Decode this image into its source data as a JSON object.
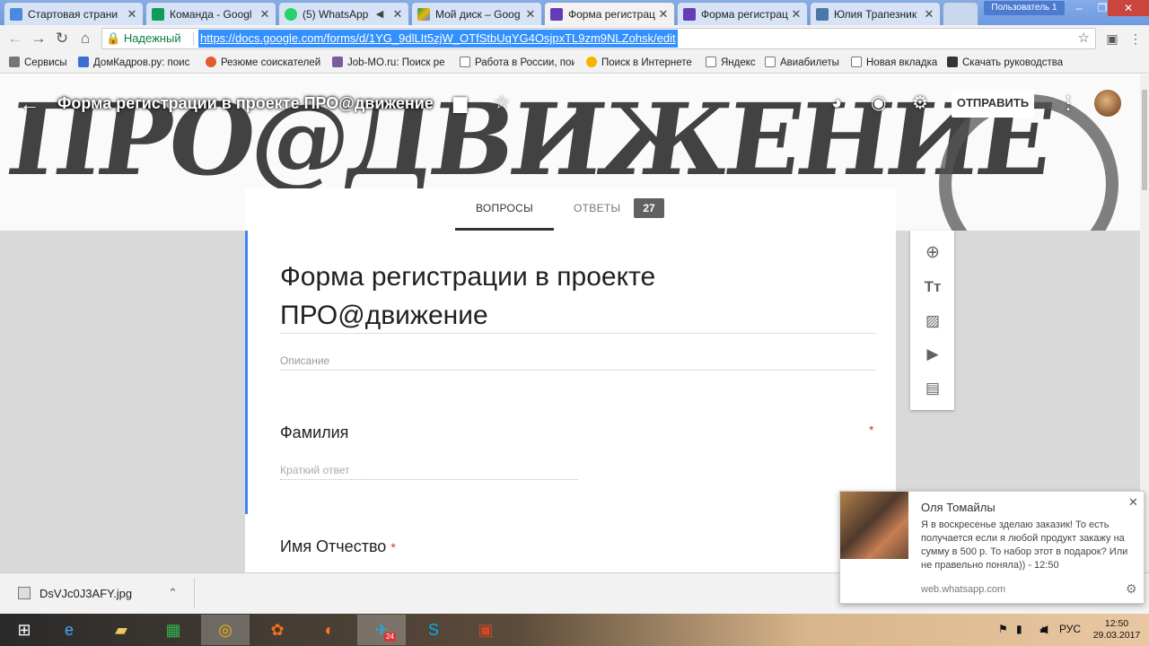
{
  "browser": {
    "tabs": [
      {
        "title": "Стартовая страни",
        "color": "#4a89dc"
      },
      {
        "title": "Команда - Googl",
        "color": "#0f9d58"
      },
      {
        "title": "(5) WhatsApp",
        "color": "#25d366"
      },
      {
        "title": "Мой диск – Goog",
        "color": "#f4b400"
      },
      {
        "title": "Форма регистрац",
        "color": "#673ab7"
      },
      {
        "title": "Форма регистрац",
        "color": "#673ab7"
      },
      {
        "title": "Юлия Трапезник",
        "color": "#4a76a8"
      }
    ],
    "user_badge": "Пользователь 1",
    "secure_label": "Надежный",
    "url": "https://docs.google.com/forms/d/1YG_9dlLIt5zjW_OTfStbUqYG4OsjpxTL9zm9NLZohsk/edit",
    "bookmarks": [
      {
        "label": "Сервисы",
        "icon": "apps-icon"
      },
      {
        "label": "ДомКадров.ру: поис",
        "icon": "people-icon"
      },
      {
        "label": "Резюме соискателей",
        "icon": "resume-icon"
      },
      {
        "label": "Job-MO.ru: Поиск ре",
        "icon": "job-icon"
      },
      {
        "label": "Работа в России, пои",
        "icon": "page-icon"
      },
      {
        "label": "Поиск в Интернете",
        "icon": "search-icon"
      },
      {
        "label": "Яндекс",
        "icon": "page-icon"
      },
      {
        "label": "Авиабилеты",
        "icon": "page-icon"
      },
      {
        "label": "Новая вкладка",
        "icon": "page-icon"
      },
      {
        "label": "Скачать руководства",
        "icon": "car-icon"
      }
    ]
  },
  "form": {
    "header_title": "Форма регистрации в проекте ПРО@движение",
    "send_label": "ОТПРАВИТЬ",
    "tab_questions": "ВОПРОСЫ",
    "tab_answers": "ОТВЕТЫ",
    "answers_count": "27",
    "title": "Форма регистрации в проекте ПРО@движение",
    "description_placeholder": "Описание",
    "q1_label": "Фамилия",
    "q1_required": "*",
    "q1_placeholder": "Краткий ответ",
    "q2_label": "Имя Отчество",
    "q2_required": "*",
    "accent_color": "#4285f4"
  },
  "download": {
    "filename": "DsVJc0J3AFY.jpg"
  },
  "notification": {
    "sender": "Оля Томайлы",
    "message": " Я в воскресенье зделаю заказик! То есть получается если я любой продукт закажу на сумму в 500 р. То набор этот в подарок? Или не правельно поняла)) - 12:50",
    "source": "web.whatsapp.com"
  },
  "taskbar": {
    "lang": "РУС",
    "time": "12:50",
    "date": "29.03.2017",
    "telegram_badge": "24"
  }
}
